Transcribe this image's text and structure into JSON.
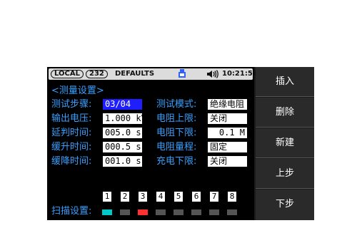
{
  "status_bar": {
    "local": "LOCAL",
    "address": "232",
    "defaults": "DEFAULTS",
    "time": "10:21:51",
    "icons": [
      "usb-icon",
      "speaker-icon"
    ]
  },
  "title": "<测量设置>",
  "left_fields": [
    {
      "label": "测试步骤:",
      "value": "03/04"
    },
    {
      "label": "输出电压:",
      "value": "1.000 kV"
    },
    {
      "label": "延判时间:",
      "value": "005.0 s"
    },
    {
      "label": "缓升时间:",
      "value": "000.5 s"
    },
    {
      "label": "缓降时间:",
      "value": "001.0 s"
    }
  ],
  "right_fields": [
    {
      "label": "测试模式:",
      "value": "绝缘电阻"
    },
    {
      "label": "电阻上限:",
      "value": "关闭"
    },
    {
      "label": "电阻下限:",
      "value": "0.1 M"
    },
    {
      "label": "电阻量程:",
      "value": "固定"
    },
    {
      "label": "充电下限:",
      "value": "关闭"
    }
  ],
  "scan": {
    "label": "扫描设置:",
    "channels": [
      "1",
      "2",
      "3",
      "4",
      "5",
      "6",
      "7",
      "8"
    ],
    "indicator_colors": [
      "#00c8c8",
      "#555555",
      "#ff3030",
      "#555555",
      "#555555",
      "#555555",
      "#555555",
      "#555555"
    ]
  },
  "side_buttons": [
    "插入",
    "删除",
    "新建",
    "上步",
    "下步"
  ],
  "colors": {
    "label": "#3aa0ff",
    "selected": "#1e1eff"
  }
}
